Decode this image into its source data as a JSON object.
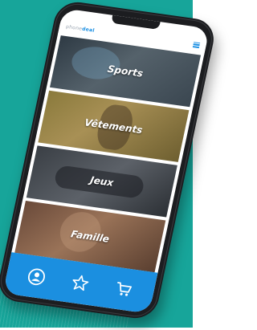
{
  "app": {
    "logo_text": "phone",
    "logo_accent": "deal"
  },
  "categories": [
    {
      "label": "Sports"
    },
    {
      "label": "Vêtements"
    },
    {
      "label": "Jeux"
    },
    {
      "label": "Famille"
    }
  ],
  "nav": {
    "items": [
      {
        "icon": "user-icon"
      },
      {
        "icon": "star-icon"
      },
      {
        "icon": "cart-icon"
      }
    ]
  },
  "colors": {
    "background_teal": "#17a59a",
    "accent_blue": "#1b8fe0",
    "phone_frame": "#1c1d20"
  }
}
